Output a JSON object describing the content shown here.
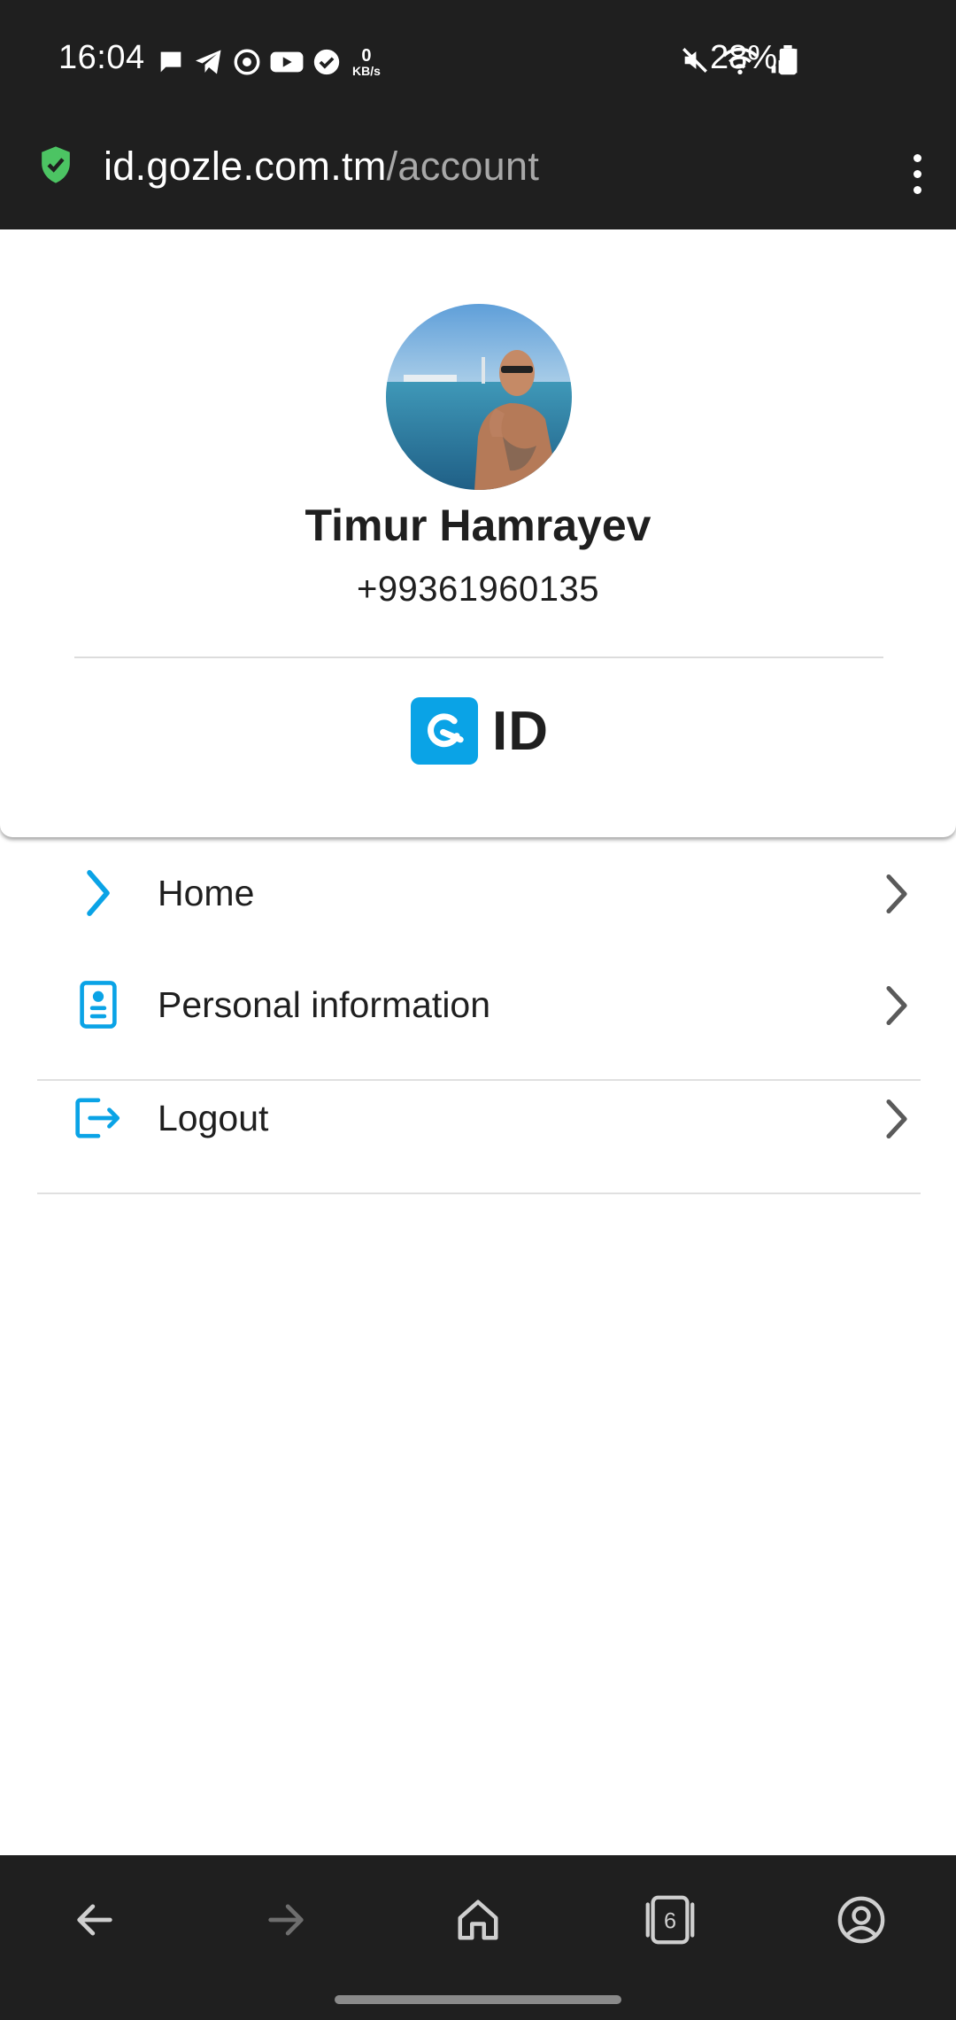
{
  "status_bar": {
    "time": "16:04",
    "net_speed_value": "0",
    "net_speed_unit": "KB/s",
    "battery_percent": "28%"
  },
  "url_bar": {
    "domain": "id.gozle.com.tm",
    "path": "/account"
  },
  "profile": {
    "name": "Timur Hamrayev",
    "phone": "+99361960135",
    "brand_text": "ID"
  },
  "menu": {
    "items": [
      {
        "label": "Home",
        "icon": "chevron-right-icon"
      },
      {
        "label": "Personal information",
        "icon": "id-card-icon"
      },
      {
        "label": "Logout",
        "icon": "logout-icon"
      }
    ]
  },
  "bottom_nav": {
    "tab_count": "6"
  },
  "colors": {
    "accent": "#0aa3e6",
    "bar_background": "#1f1f1f",
    "secure_shield": "#4cc463"
  }
}
